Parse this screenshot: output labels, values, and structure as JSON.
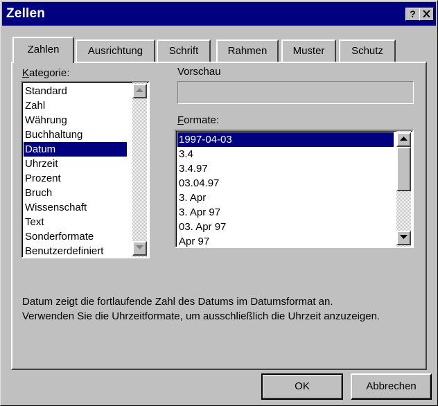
{
  "window": {
    "title": "Zellen",
    "help_label": "?",
    "close_label": "✕"
  },
  "tabs": [
    {
      "label": "Zahlen",
      "active": true
    },
    {
      "label": "Ausrichtung",
      "active": false
    },
    {
      "label": "Schrift",
      "active": false
    },
    {
      "label": "Rahmen",
      "active": false
    },
    {
      "label": "Muster",
      "active": false
    },
    {
      "label": "Schutz",
      "active": false
    }
  ],
  "kategorie": {
    "label_accel": "K",
    "label_rest": "ategorie:",
    "items": [
      "Standard",
      "Zahl",
      "Währung",
      "Buchhaltung",
      "Datum",
      "Uhrzeit",
      "Prozent",
      "Bruch",
      "Wissenschaft",
      "Text",
      "Sonderformate",
      "Benutzerdefiniert"
    ],
    "selected": "Datum"
  },
  "vorschau": {
    "label": "Vorschau",
    "value": ""
  },
  "formate": {
    "label_accel": "F",
    "label_rest": "ormate:",
    "items": [
      "1997-04-03",
      "3.4",
      "3.4.97",
      "03.04.97",
      "3. Apr",
      "3. Apr 97",
      "03. Apr 97",
      "Apr 97"
    ],
    "selected": "1997-04-03"
  },
  "description": {
    "line1": "Datum zeigt die fortlaufende Zahl des Datums im Datumsformat an.",
    "line2": "Verwenden Sie die Uhrzeitformate, um ausschließlich die Uhrzeit anzuzeigen."
  },
  "buttons": {
    "ok": "OK",
    "cancel": "Abbrechen"
  },
  "colors": {
    "titlebar": "#000080",
    "selection": "#000080",
    "face": "#c0c0c0"
  }
}
